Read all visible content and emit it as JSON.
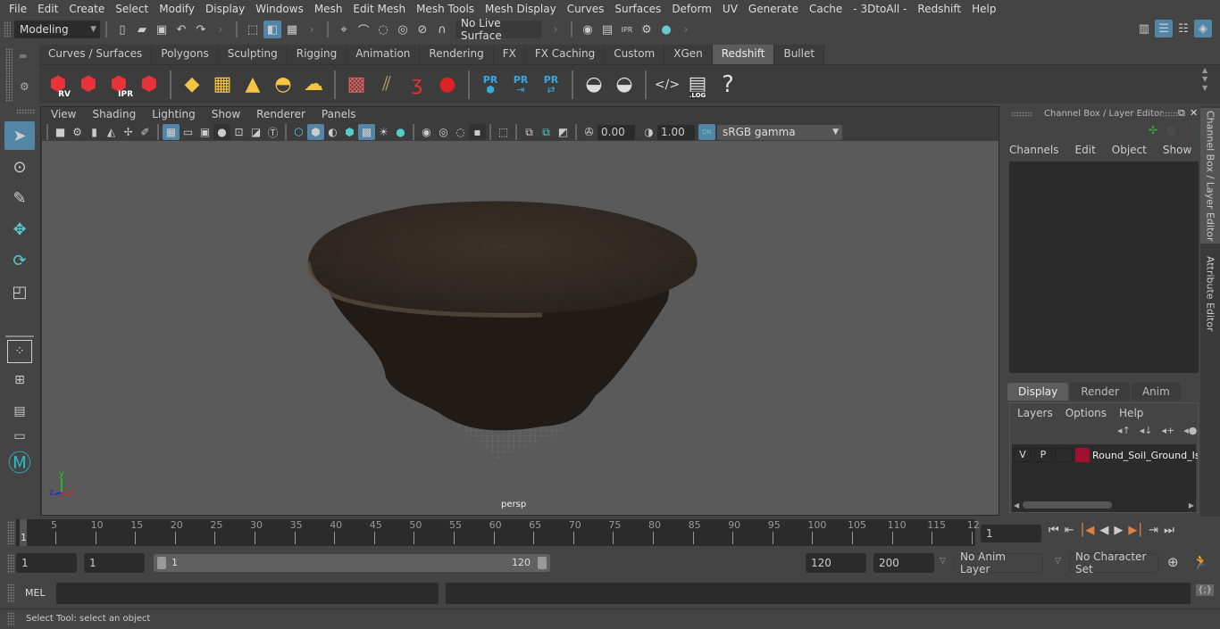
{
  "menubar": {
    "items": [
      "File",
      "Edit",
      "Create",
      "Select",
      "Modify",
      "Display",
      "Windows",
      "Mesh",
      "Edit Mesh",
      "Mesh Tools",
      "Mesh Display",
      "Curves",
      "Surfaces",
      "Deform",
      "UV",
      "Generate",
      "Cache",
      "- 3DtoAll -",
      "Redshift",
      "Help"
    ]
  },
  "statusline": {
    "mode": "Modeling",
    "live_surface": "No Live Surface"
  },
  "shelf": {
    "tabs": [
      "Curves / Surfaces",
      "Polygons",
      "Sculpting",
      "Rigging",
      "Animation",
      "Rendering",
      "FX",
      "FX Caching",
      "Custom",
      "XGen",
      "Redshift",
      "Bullet"
    ],
    "active_tab": "Redshift",
    "icons": [
      "redshift-rv-icon",
      "redshift-render-icon",
      "redshift-ipr-icon",
      "redshift-settings-icon",
      "area-light-icon",
      "portal-light-icon",
      "spot-light-icon",
      "dome-light-icon",
      "sun-sky-icon",
      "proxy-cube-icon",
      "hair-icon",
      "volume-icon",
      "sphere-icon",
      "pr-object-icon",
      "pr-export-icon",
      "pr-sync-icon",
      "bake-icon",
      "bake-single-icon",
      "script-icon",
      "log-icon",
      "help-icon"
    ],
    "labels": {
      "rv": "RV",
      "ipr": "IPR",
      "pr": "PR",
      "log": ".LOG",
      "help": "?"
    }
  },
  "viewport": {
    "menu": [
      "View",
      "Shading",
      "Lighting",
      "Show",
      "Renderer",
      "Panels"
    ],
    "exposure": "0.00",
    "gamma": "1.00",
    "color_on": "ON",
    "color_space": "sRGB gamma",
    "camera_label": "persp",
    "axis": {
      "x": "x",
      "y": "y",
      "z": "z"
    }
  },
  "channel_box": {
    "title": "Channel Box / Layer Editor",
    "menu": [
      "Channels",
      "Edit",
      "Object",
      "Show"
    ]
  },
  "layer_editor": {
    "tabs": [
      "Display",
      "Render",
      "Anim"
    ],
    "active_tab": "Display",
    "menu": [
      "Layers",
      "Options",
      "Help"
    ],
    "layers": [
      {
        "v": "V",
        "p": "P",
        "color": "#a0112f",
        "name": "Round_Soil_Ground_Is"
      }
    ]
  },
  "side_tabs": [
    "Channel Box / Layer Editor",
    "Attribute Editor"
  ],
  "timeline": {
    "ticks": [
      "5",
      "10",
      "15",
      "20",
      "25",
      "30",
      "35",
      "40",
      "45",
      "50",
      "55",
      "60",
      "65",
      "70",
      "75",
      "80",
      "85",
      "90",
      "95",
      "100",
      "105",
      "110",
      "115",
      "12"
    ],
    "current_frame_marker": "1",
    "current_frame": "1"
  },
  "range": {
    "start": "1",
    "playback_start": "1",
    "slider_start": "1",
    "slider_end": "120",
    "playback_end": "120",
    "end": "200",
    "anim_layer": "No Anim Layer",
    "character_set": "No Character Set"
  },
  "cmdline": {
    "label": "MEL"
  },
  "helpline": {
    "text": "Select Tool: select an object"
  }
}
